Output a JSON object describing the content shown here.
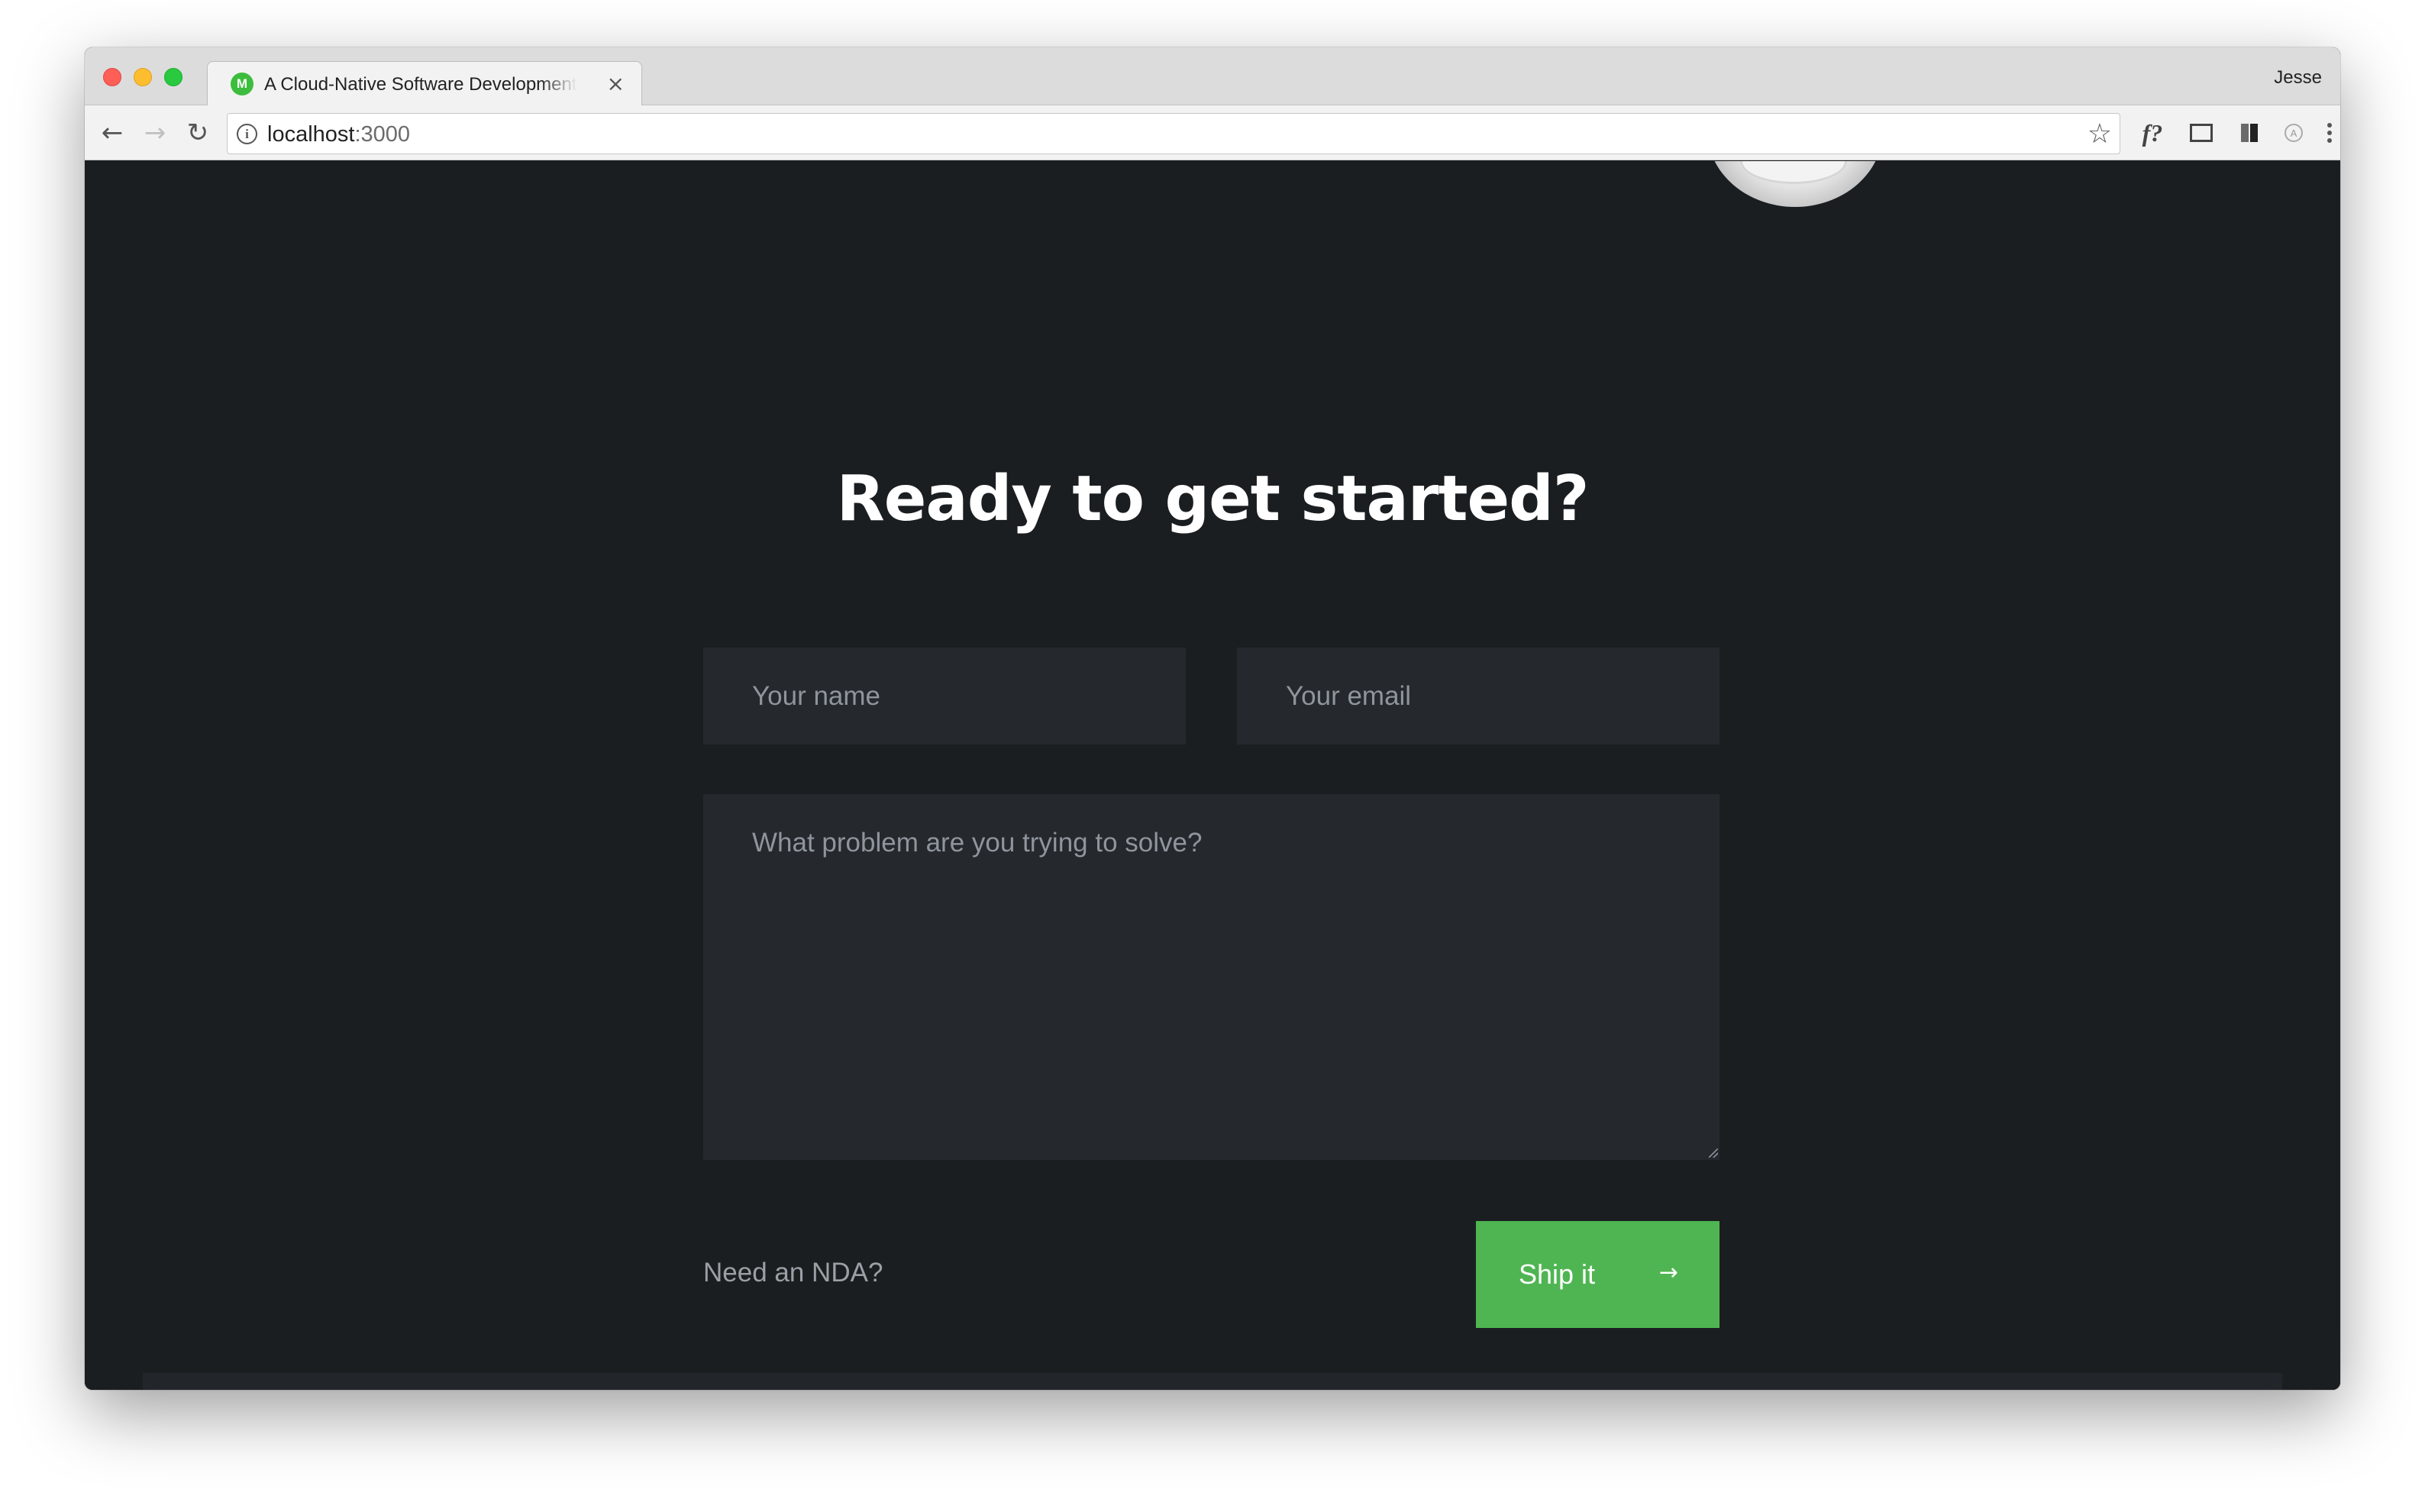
{
  "browser": {
    "tab_title": "A Cloud-Native Software Development Company",
    "tab_close_glyph": "×",
    "favicon_letter": "M",
    "profile_name": "Jesse",
    "url_host": "localhost",
    "url_port": ":3000",
    "icons": {
      "back": "←",
      "forward": "→",
      "reload": "↻",
      "info": "i",
      "star": "☆",
      "fonts_ext": "f?"
    },
    "accent_favicon": "#3dbd3d"
  },
  "page": {
    "heading": "Ready to get started?",
    "form": {
      "name_placeholder": "Your name",
      "email_placeholder": "Your email",
      "problem_placeholder": "What problem are you trying to solve?",
      "nda_link": "Need an NDA?",
      "submit_label": "Ship it",
      "submit_arrow": "→"
    },
    "colors": {
      "background": "#1b1e21",
      "field_bg": "#25282d",
      "button_green": "#4fb552",
      "heading": "#ffffff"
    }
  }
}
